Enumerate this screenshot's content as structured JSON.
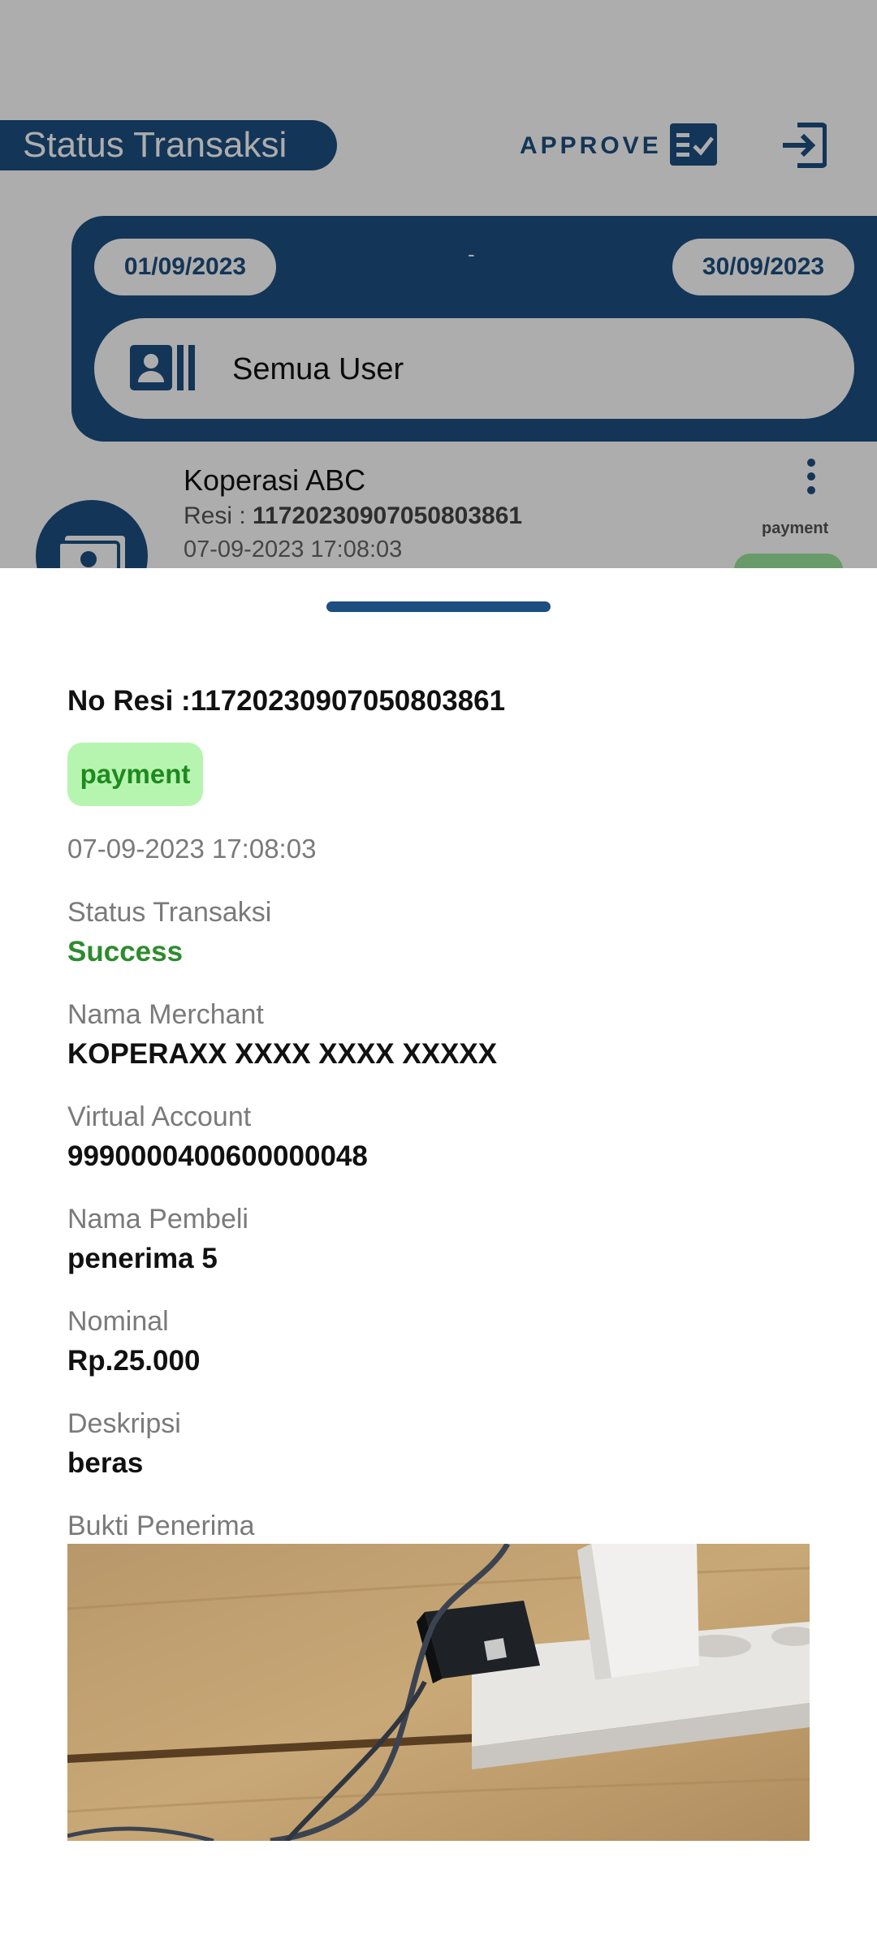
{
  "header": {
    "title": "Status Transaksi",
    "approve_label": "APPROVE"
  },
  "filter": {
    "date_start": "01/09/2023",
    "separator": "-",
    "date_end": "30/09/2023",
    "user_filter": "Semua User"
  },
  "list_item": {
    "name": "Koperasi ABC",
    "resi_prefix": "Resi : ",
    "resi": "11720230907050803861",
    "datetime": "07-09-2023 17:08:03",
    "type": "payment"
  },
  "detail": {
    "no_resi_label": "No Resi :11720230907050803861",
    "type_badge": "payment",
    "datetime": "07-09-2023 17:08:03",
    "fields": [
      {
        "label": "Status Transaksi",
        "value": "Success"
      },
      {
        "label": "Nama Merchant",
        "value": "KOPERAXX XXXX XXXX XXXXX"
      },
      {
        "label": "Virtual Account",
        "value": "9990000400600000048"
      },
      {
        "label": "Nama Pembeli",
        "value": "penerima 5"
      },
      {
        "label": "Nominal",
        "value": "Rp.25.000"
      },
      {
        "label": "Deskripsi",
        "value": "beras"
      }
    ],
    "proof_label": "Bukti Penerima"
  },
  "colors": {
    "primary": "#1c4e80",
    "success": "#2e8b2e",
    "badge_bg": "#b6f5b0",
    "badge_text": "#1f8a1f"
  }
}
